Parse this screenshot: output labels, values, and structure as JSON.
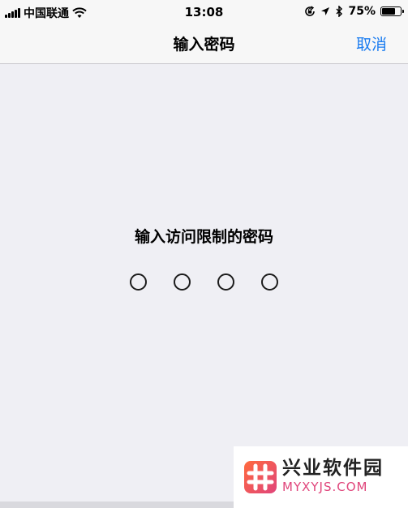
{
  "status_bar": {
    "carrier": "中国联通",
    "time": "13:08",
    "battery_percent": "75%",
    "battery_level": 0.75,
    "icons": [
      "signal-icon",
      "wifi-icon",
      "orientation-lock-icon",
      "location-icon",
      "bluetooth-icon",
      "battery-icon"
    ]
  },
  "nav": {
    "title": "输入密码",
    "cancel_label": "取消"
  },
  "main": {
    "prompt": "输入访问限制的密码",
    "passcode_digits": 4,
    "entered_digits": 0
  },
  "watermark": {
    "name": "兴业软件园",
    "url": "MYXYJS.COM"
  },
  "colors": {
    "background": "#efeff4",
    "bar_background": "#f7f7f7",
    "accent": "#1a7cf0",
    "watermark_accent": "#e0457b"
  }
}
